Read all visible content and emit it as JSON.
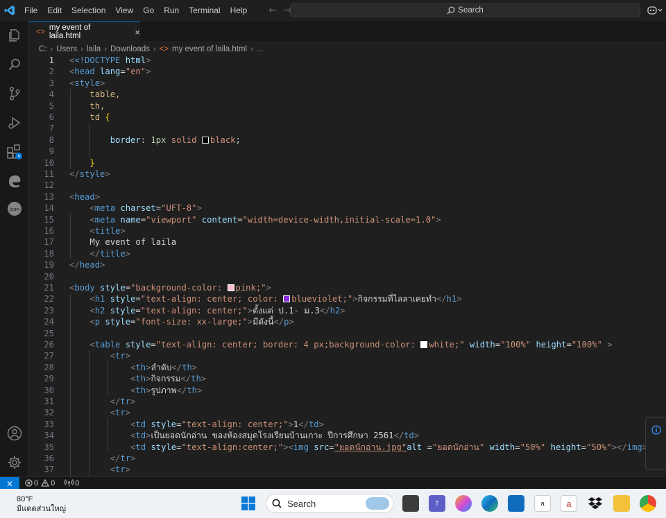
{
  "menu": [
    "File",
    "Edit",
    "Selection",
    "View",
    "Go",
    "Run",
    "Terminal",
    "Help"
  ],
  "search": {
    "label": "Search"
  },
  "tab": {
    "label": "my event of laila.html",
    "close": "×"
  },
  "breadcrumb": [
    "C:",
    "Users",
    "laila",
    "Downloads",
    "my event of laila.html",
    "..."
  ],
  "status": {
    "errors": "0",
    "warnings": "0",
    "ports": "0"
  },
  "taskbar": {
    "temp": "80°F",
    "weather_text": "มีแดดส่วนใหญ่",
    "search_label": "Search"
  },
  "colors": {
    "accent": "#0078d4",
    "editor_bg": "#1f1f1f",
    "tag": "#569cd6",
    "attr": "#9cdcfe",
    "string": "#ce9178"
  },
  "code": {
    "l1a": "<!DOCTYPE",
    "l1b": " html",
    "l1c": ">",
    "l2": "head",
    "l2attr": "lang",
    "l2val": "\"en\"",
    "l3": "style",
    "l4": "table,",
    "l5": "th,",
    "l6": "td",
    "l8prop": "border",
    "l8num": "1px",
    "l8val": "solid",
    "l8col": "black",
    "l11": "style",
    "l13": "head",
    "l14": "meta",
    "l14attr": "charset",
    "l14val": "\"UFT-8\"",
    "l15": "meta",
    "l15attr1": "name",
    "l15val1": "\"viewport\"",
    "l15attr2": "content",
    "l15val2": "\"width=device-width,initial-scale=1.0\"",
    "l16": "title",
    "l17": "My event of laila",
    "l18": "title",
    "l19": "head",
    "l21": "body",
    "l21attr": "style",
    "l21val1": "\"background-color: ",
    "l21val2": "pink;\"",
    "l22": "h1",
    "l22attr": "style",
    "l22val1": "\"text-align: center; color: ",
    "l22val2": "blueviolet;\"",
    "l22text": "กิจกรรมที่ไลลาเคยทำ",
    "l23": "h2",
    "l23attr": "style",
    "l23val": "\"text-align: center;\"",
    "l23text": "ตั้งแต่ ป.1- ม.3",
    "l24": "p",
    "l24attr": "style",
    "l24val": "\"font-size: xx-large;\"",
    "l24text": "มีดังนี้",
    "l26": "table",
    "l26attr": "style",
    "l26val1": "\"text-align: center; border: 4 px;background-color: ",
    "l26val2": "white;\"",
    "l26attr2": "width",
    "l26val3": "\"100%\"",
    "l26attr3": "height",
    "l26val4": "\"100%\"",
    "tr": "tr",
    "th": "th",
    "td": "td",
    "l28text": "ลำดับ",
    "l29text": "กิจกรรม",
    "l30text": "รูปภาพ",
    "l33attr": "style",
    "l33val": "\"text-align: center;\"",
    "l33text": "1",
    "l34text": "เป็นยอดนักอ่าน ของห้องสมุดโรงเรียนบ้านเกาะ ปีการศึกษา 2561",
    "l35attr": "style",
    "l35val": "\"text-align:center;\"",
    "l35img": "img",
    "l35src": "src",
    "l35srcval": "\"ยอดนักอ่าน.jpg\"",
    "l35alt": "alt",
    "l35altval": "\"ยอดนักอ่าน\"",
    "l35w": "width",
    "l35wval": "\"50%\"",
    "l35h": "height",
    "l35hval": "\"50%\""
  }
}
